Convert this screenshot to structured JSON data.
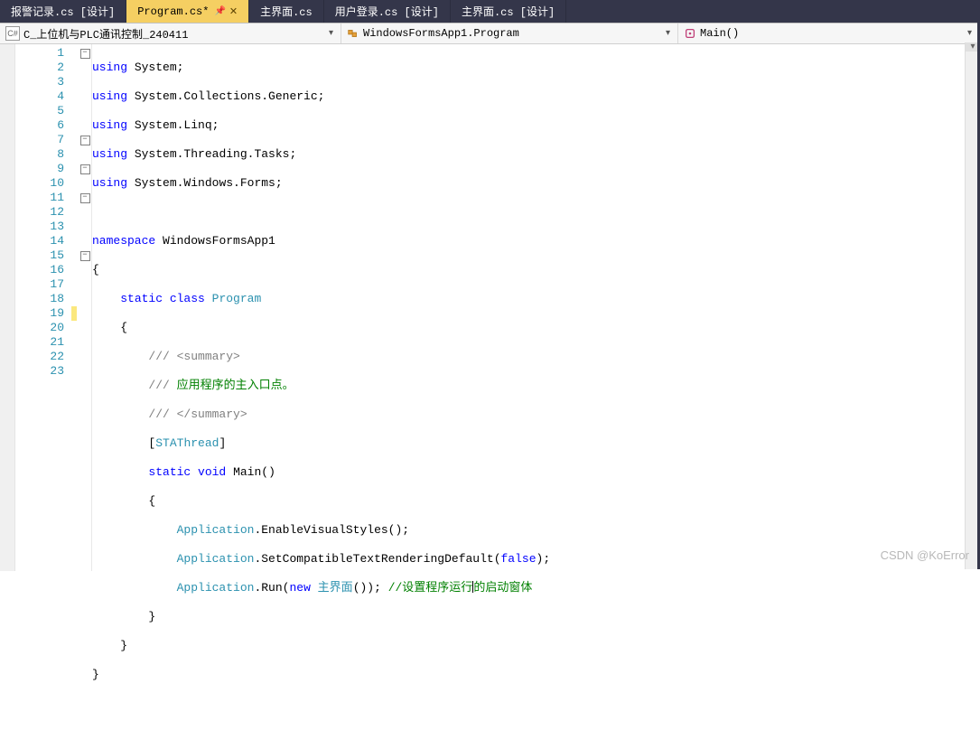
{
  "tabs": [
    {
      "label": "报警记录.cs [设计]"
    },
    {
      "label": "Program.cs*"
    },
    {
      "label": "主界面.cs"
    },
    {
      "label": "用户登录.cs [设计]"
    },
    {
      "label": "主界面.cs [设计]"
    }
  ],
  "nav": {
    "project": "C_上位机与PLC通讯控制_240411",
    "class": "WindowsFormsApp1.Program",
    "method": "Main()"
  },
  "lines": [
    "1",
    "2",
    "3",
    "4",
    "5",
    "6",
    "7",
    "8",
    "9",
    "10",
    "11",
    "12",
    "13",
    "14",
    "15",
    "16",
    "17",
    "18",
    "19",
    "20",
    "21",
    "22",
    "23"
  ],
  "code": {
    "l1_kw": "using",
    "l1_ns": "System",
    "l2_kw": "using",
    "l2_ns": "System.Collections.Generic",
    "l3_kw": "using",
    "l3_ns": "System.Linq",
    "l4_kw": "using",
    "l4_ns": "System.Threading.Tasks",
    "l5_kw": "using",
    "l5_ns": "System.Windows.Forms",
    "l7_kw": "namespace",
    "l7_ns": "WindowsFormsApp1",
    "l8": "{",
    "l9_kw": "static class",
    "l9_name": "Program",
    "l10": "{",
    "l11": "/// <summary>",
    "l12": "/// 应用程序的主入口点。",
    "l13": "/// </summary>",
    "l14_a": "[",
    "l14_b": "STAThread",
    "l14_c": "]",
    "l15_kw": "static void",
    "l15_name": "Main()",
    "l16": "{",
    "l17_a": "Application",
    "l17_b": ".EnableVisualStyles();",
    "l18_a": "Application",
    "l18_b": ".SetCompatibleTextRenderingDefault(",
    "l18_kw": "false",
    "l18_c": ");",
    "l19_a": "Application",
    "l19_b": ".Run(",
    "l19_kw": "new",
    "l19_c": " 主界面",
    "l19_d": "()); ",
    "l19_cm": "//设置程序运行的启动窗体",
    "l20": "}",
    "l21": "}",
    "l22": "}"
  },
  "watermark": "CSDN @KoError"
}
